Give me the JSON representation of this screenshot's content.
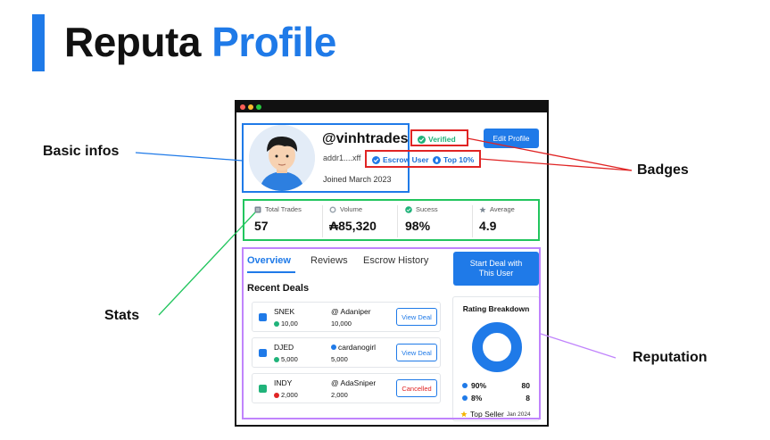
{
  "title": {
    "word1": "Reputa",
    "word2": "Profile"
  },
  "callouts": {
    "basic_infos": "Basic infos",
    "stats": "Stats",
    "badges": "Badges",
    "reputation": "Reputation"
  },
  "colors": {
    "accent": "#1f7ae8",
    "verified": "#20b37a",
    "cancel": "#e02424",
    "basic_outline": "#1f7ae8",
    "stats_outline": "#22c55e",
    "badges_outline": "#e02424",
    "reputation_outline": "#c084fc"
  },
  "profile": {
    "username": "@vinhtrades",
    "address": "addr1....xff",
    "joined": "Joined March 2023",
    "verified": "Verified",
    "escrow_badge": "Escrow User",
    "top_badge": "Top 10%",
    "edit_button": "Edit Profile"
  },
  "stats": [
    {
      "label": "Total Trades",
      "value": "57",
      "icon": "list-icon"
    },
    {
      "label": "Volume",
      "value": "₳85,320",
      "icon": "coin-icon"
    },
    {
      "label": "Sucess",
      "value": "98%",
      "icon": "check-circle-icon"
    },
    {
      "label": "Average",
      "value": "4.9",
      "icon": "star-icon"
    }
  ],
  "tabs": [
    "Overview",
    "Reviews",
    "Escrow History"
  ],
  "start_deal_button": [
    "Start Deal with",
    "This User"
  ],
  "recent_deals_title": "Recent Deals",
  "deals": [
    {
      "token": "SNEK",
      "amount": "10,00",
      "counterparty": "@ Adaniper",
      "cp_amount": "10,000",
      "action": "View Deal"
    },
    {
      "token": "DJED",
      "amount": "5,000",
      "counterparty": "cardanogirl",
      "cp_amount": "5,000",
      "action": "View Deal"
    },
    {
      "token": "INDY",
      "amount": "2,000",
      "counterparty": "@ AdaSniper",
      "cp_amount": "2,000",
      "action": "Cancelled"
    }
  ],
  "rating": {
    "title": "Rating Breakdown",
    "rows": [
      {
        "pct": "90%",
        "count": "80"
      },
      {
        "pct": "8%",
        "count": "8"
      }
    ],
    "top_seller": "Top Seller",
    "top_seller_date": "Jan 2024"
  }
}
